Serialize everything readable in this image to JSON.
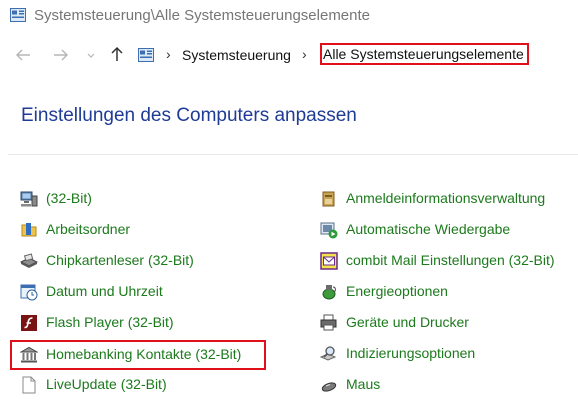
{
  "window": {
    "title": "Systemsteuerung\\Alle Systemsteuerungselemente",
    "icon": "control-panel-icon"
  },
  "nav": {
    "back_icon": "arrow-left-icon",
    "forward_icon": "arrow-right-icon",
    "up_icon": "arrow-up-icon"
  },
  "address": {
    "icon": "control-panel-icon",
    "crumbs": [
      "Systemsteuerung",
      "Alle Systemsteuerungselemente"
    ],
    "highlight_color": "#e0101a"
  },
  "main": {
    "heading": "Einstellungen des Computers anpassen",
    "heading_color": "#1e3c96",
    "link_color": "#1c7a1c",
    "left_column": [
      {
        "label": "(32-Bit)",
        "icon": "computer-icon"
      },
      {
        "label": "Arbeitsordner",
        "icon": "work-folder-icon"
      },
      {
        "label": "Chipkartenleser (32-Bit)",
        "icon": "card-reader-icon"
      },
      {
        "label": "Datum und Uhrzeit",
        "icon": "calendar-clock-icon"
      },
      {
        "label": "Flash Player (32-Bit)",
        "icon": "flash-icon"
      },
      {
        "label": "Homebanking Kontakte (32-Bit)",
        "icon": "bank-icon",
        "highlighted": true
      },
      {
        "label": "LiveUpdate (32-Bit)",
        "icon": "document-icon"
      }
    ],
    "right_column": [
      {
        "label": "Anmeldeinformationsverwaltung",
        "icon": "credential-vault-icon"
      },
      {
        "label": "Automatische Wiedergabe",
        "icon": "autoplay-icon"
      },
      {
        "label": "combit Mail Einstellungen (32-Bit)",
        "icon": "mail-icon"
      },
      {
        "label": "Energieoptionen",
        "icon": "power-options-icon"
      },
      {
        "label": "Geräte und Drucker",
        "icon": "printer-icon"
      },
      {
        "label": "Indizierungsoptionen",
        "icon": "search-index-icon"
      },
      {
        "label": "Maus",
        "icon": "mouse-icon"
      }
    ]
  }
}
